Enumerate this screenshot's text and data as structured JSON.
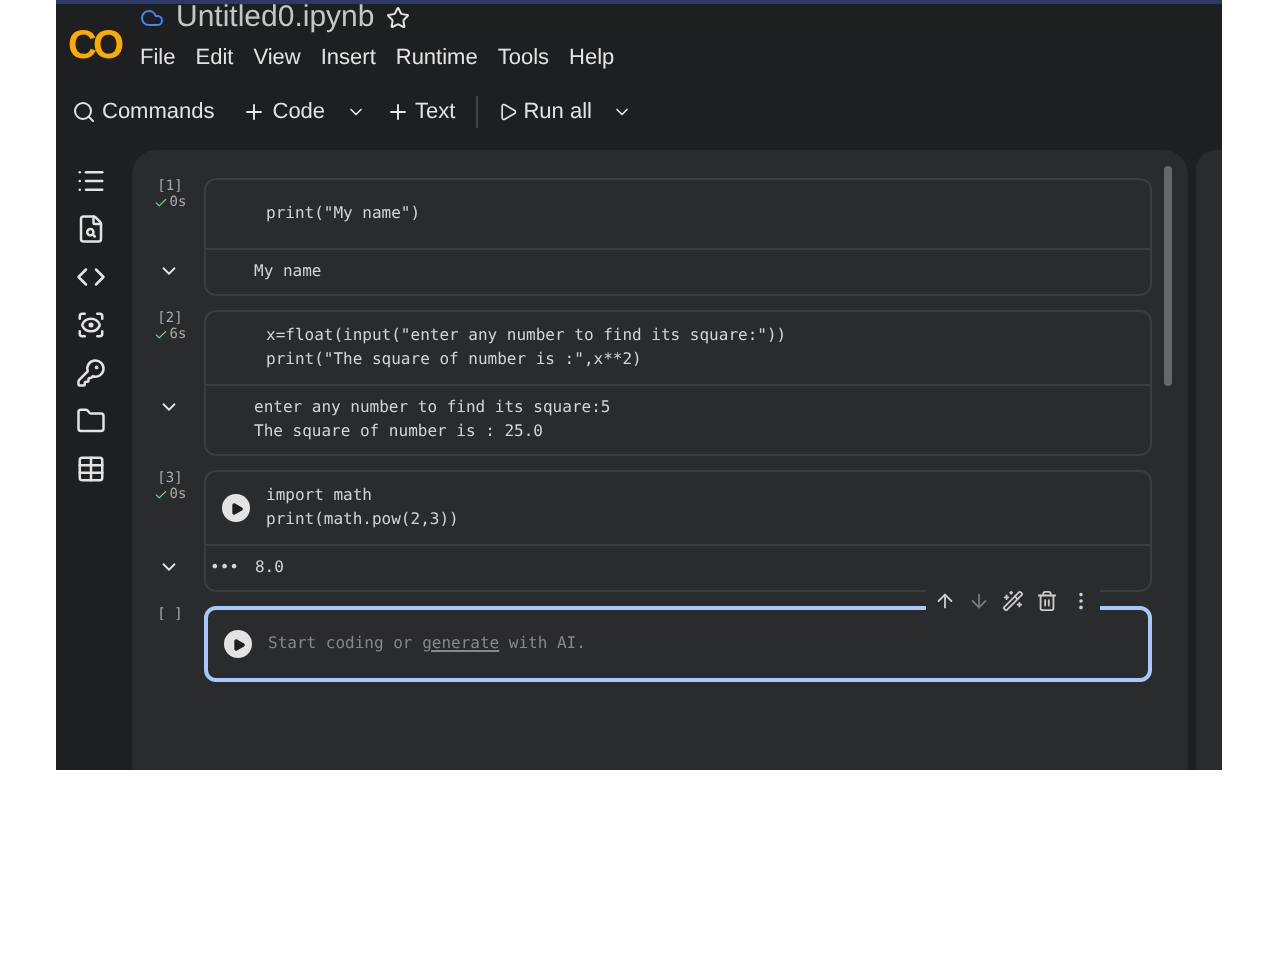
{
  "header": {
    "logo": "CO",
    "title": "Untitled0.ipynb",
    "starred": false,
    "menu": [
      "File",
      "Edit",
      "View",
      "Insert",
      "Runtime",
      "Tools",
      "Help"
    ]
  },
  "toolbar": {
    "commands": "Commands",
    "code": "Code",
    "text": "Text",
    "run_all": "Run all"
  },
  "cells": [
    {
      "label": "[1]",
      "time": "0s",
      "done": true,
      "run_button": false,
      "selected": false,
      "code": [
        "print(\"My name\")"
      ],
      "output": [
        "My name"
      ]
    },
    {
      "label": "[2]",
      "time": "6s",
      "done": true,
      "run_button": false,
      "selected": false,
      "code": [
        "x=float(input(\"enter any number to find its square:\"))",
        "print(\"The square of number is :\",x**2)"
      ],
      "output": [
        "enter any number to find its square:5",
        "The square of number is : 25.0"
      ]
    },
    {
      "label": "[3]",
      "time": "0s",
      "done": true,
      "run_button": true,
      "selected": false,
      "code": [
        "import math",
        "print(math.pow(2,3))"
      ],
      "output_marker": "•••",
      "output": [
        "8.0"
      ]
    },
    {
      "label": "[ ]",
      "done": false,
      "run_button": true,
      "selected": true,
      "placeholder": [
        "Start coding or ",
        "generate",
        " with AI."
      ]
    }
  ]
}
